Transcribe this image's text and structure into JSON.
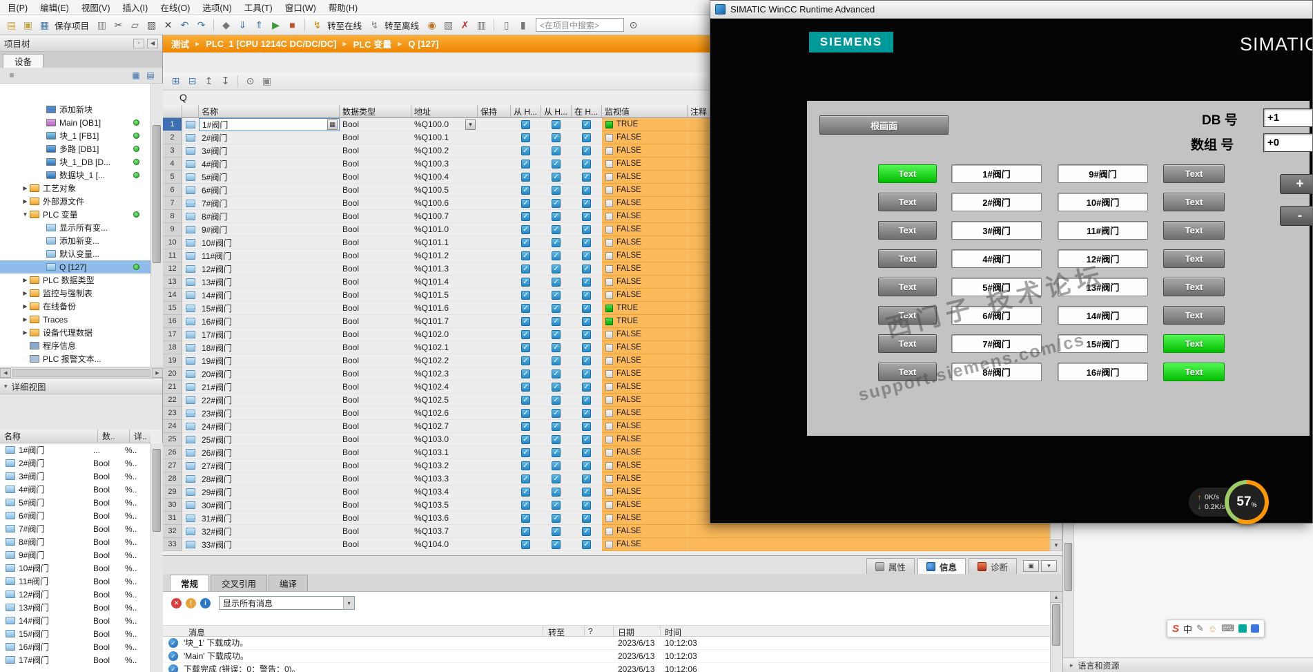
{
  "menubar": {
    "items": [
      "目(P)",
      "编辑(E)",
      "视图(V)",
      "插入(I)",
      "在线(O)",
      "选项(N)",
      "工具(T)",
      "窗口(W)",
      "帮助(H)"
    ]
  },
  "toolbar": {
    "search_placeholder": "<在项目中搜索>",
    "items": [
      {
        "n": "new-project-icon",
        "g": "▤",
        "c": "#D9A441"
      },
      {
        "n": "open-project-icon",
        "g": "▣",
        "c": "#C2A84A"
      },
      {
        "n": "save-project-icon",
        "g": "▦",
        "c": "#4A7CB8"
      },
      {
        "n": "save-project-label",
        "t": "保存项目"
      },
      {
        "n": "print-icon",
        "g": "▥",
        "c": "#8A8A8A"
      },
      {
        "n": "cut-icon",
        "g": "✂",
        "c": "#555"
      },
      {
        "n": "copy-icon",
        "g": "▱",
        "c": "#555"
      },
      {
        "n": "paste-icon",
        "g": "▨",
        "c": "#555"
      },
      {
        "n": "delete-icon",
        "g": "✕",
        "c": "#444"
      },
      {
        "n": "undo-icon",
        "g": "↶",
        "c": "#3A6FB0"
      },
      {
        "n": "redo-icon",
        "g": "↷",
        "c": "#3A6FB0"
      },
      {
        "sep": true
      },
      {
        "n": "compile-icon",
        "g": "◆",
        "c": "#777777"
      },
      {
        "n": "download-to-device-icon",
        "g": "⇓",
        "c": "#3A6FB0"
      },
      {
        "n": "upload-from-device-icon",
        "g": "⇑",
        "c": "#3A6FB0"
      },
      {
        "n": "start-cpu-icon",
        "g": "▶",
        "c": "#3A9A3A"
      },
      {
        "n": "stop-cpu-icon",
        "g": "■",
        "c": "#C05030"
      },
      {
        "sep": true
      },
      {
        "n": "go-online-icon",
        "g": "↯",
        "c": "#D88500"
      },
      {
        "n": "go-online-label",
        "t": "转至在线"
      },
      {
        "n": "go-offline-icon",
        "g": "↯",
        "c": "#888888"
      },
      {
        "n": "go-offline-label",
        "t": "转至离线"
      },
      {
        "n": "online-diagnostics-icon",
        "g": "◉",
        "c": "#C07020"
      },
      {
        "n": "simulation-icon",
        "g": "▧",
        "c": "#777777"
      },
      {
        "n": "cancel-icon",
        "g": "✗",
        "c": "#C03030"
      },
      {
        "n": "cross-reference-icon",
        "g": "▥",
        "c": "#777777"
      },
      {
        "sep": true
      },
      {
        "n": "split-editor-vertical-icon",
        "g": "▯",
        "c": "#777777"
      },
      {
        "n": "split-editor-horizontal-icon",
        "g": "▮",
        "c": "#777777"
      },
      {
        "search": true
      },
      {
        "n": "find-icon",
        "g": "⊙",
        "c": "#555555"
      }
    ]
  },
  "breadcrumb": {
    "items": [
      "测试",
      "PLC_1 [CPU 1214C DC/DC/DC]",
      "PLC 变量",
      "Q [127]"
    ]
  },
  "project_tree": {
    "title": "项目树",
    "tab": "设备",
    "items": [
      {
        "l": "添加新块",
        "lv": 3,
        "ic": "add"
      },
      {
        "l": "Main [OB1]",
        "lv": 3,
        "ic": "ob",
        "dot": 1
      },
      {
        "l": "块_1 [FB1]",
        "lv": 3,
        "ic": "fb",
        "dot": 1
      },
      {
        "l": "多路 [DB1]",
        "lv": 3,
        "ic": "db",
        "dot": 1
      },
      {
        "l": "块_1_DB [D...",
        "lv": 3,
        "ic": "db",
        "dot": 1
      },
      {
        "l": "数据块_1 [...",
        "lv": 3,
        "ic": "db",
        "dot": 1
      },
      {
        "l": "工艺对象",
        "lv": 2,
        "ic": "folder",
        "ar": "c"
      },
      {
        "l": "外部源文件",
        "lv": 2,
        "ic": "folder",
        "ar": "c"
      },
      {
        "l": "PLC 变量",
        "lv": 2,
        "ic": "tagfolder",
        "ar": "e",
        "dot": 1
      },
      {
        "l": "显示所有变...",
        "lv": 3,
        "ic": "tag"
      },
      {
        "l": "添加新变...",
        "lv": 3,
        "ic": "tagadd"
      },
      {
        "l": "默认变量...",
        "lv": 3,
        "ic": "tag"
      },
      {
        "l": "Q [127]",
        "lv": 3,
        "ic": "tag",
        "dot": 1,
        "sel": 1
      },
      {
        "l": "PLC 数据类型",
        "lv": 2,
        "ic": "folder2",
        "ar": "c"
      },
      {
        "l": "监控与强制表",
        "lv": 2,
        "ic": "folder2",
        "ar": "c"
      },
      {
        "l": "在线备份",
        "lv": 2,
        "ic": "folder2",
        "ar": "c"
      },
      {
        "l": "Traces",
        "lv": 2,
        "ic": "folder2",
        "ar": "c"
      },
      {
        "l": "设备代理数据",
        "lv": 2,
        "ic": "folder2",
        "ar": "c"
      },
      {
        "l": "程序信息",
        "lv": 2,
        "ic": "info"
      },
      {
        "l": "PLC 报警文本...",
        "lv": 2,
        "ic": "alarm"
      }
    ]
  },
  "detail_view": {
    "title": "详细视图",
    "columns": [
      "名称",
      "数..",
      "详.."
    ],
    "rows": [
      [
        "1#阀门",
        "...",
        "%.."
      ],
      [
        "2#阀门",
        "Bool",
        "%.."
      ],
      [
        "3#阀门",
        "Bool",
        "%.."
      ],
      [
        "4#阀门",
        "Bool",
        "%.."
      ],
      [
        "5#阀门",
        "Bool",
        "%.."
      ],
      [
        "6#阀门",
        "Bool",
        "%.."
      ],
      [
        "7#阀门",
        "Bool",
        "%.."
      ],
      [
        "8#阀门",
        "Bool",
        "%.."
      ],
      [
        "9#阀门",
        "Bool",
        "%.."
      ],
      [
        "10#阀门",
        "Bool",
        "%.."
      ],
      [
        "11#阀门",
        "Bool",
        "%.."
      ],
      [
        "12#阀门",
        "Bool",
        "%.."
      ],
      [
        "13#阀门",
        "Bool",
        "%.."
      ],
      [
        "14#阀门",
        "Bool",
        "%.."
      ],
      [
        "15#阀门",
        "Bool",
        "%.."
      ],
      [
        "16#阀门",
        "Bool",
        "%.."
      ],
      [
        "17#阀门",
        "Bool",
        "%.."
      ]
    ]
  },
  "table_toolbar": {
    "items": [
      {
        "n": "add-row-icon",
        "g": "⊞",
        "c": "#4A7CB8"
      },
      {
        "n": "insert-row-icon",
        "g": "⊟",
        "c": "#4A7CB8"
      },
      {
        "n": "export-icon",
        "g": "↥",
        "c": "#666666"
      },
      {
        "n": "import-icon",
        "g": "↧",
        "c": "#666666"
      },
      {
        "sep": true
      },
      {
        "n": "monitor-all-icon",
        "g": "⊙",
        "c": "#666666"
      },
      {
        "n": "snapshot-icon",
        "g": "▣",
        "c": "#888888"
      }
    ]
  },
  "tag_table": {
    "title": "Q",
    "columns": [
      "名称",
      "数据类型",
      "地址",
      "保持",
      "从 H...",
      "从 H...",
      "在 H...",
      "监视值",
      "注释"
    ],
    "selected_row": 0,
    "rows": [
      [
        "1#阀门",
        "Bool",
        "%Q100.0",
        "TRUE"
      ],
      [
        "2#阀门",
        "Bool",
        "%Q100.1",
        "FALSE"
      ],
      [
        "3#阀门",
        "Bool",
        "%Q100.2",
        "FALSE"
      ],
      [
        "4#阀门",
        "Bool",
        "%Q100.3",
        "FALSE"
      ],
      [
        "5#阀门",
        "Bool",
        "%Q100.4",
        "FALSE"
      ],
      [
        "6#阀门",
        "Bool",
        "%Q100.5",
        "FALSE"
      ],
      [
        "7#阀门",
        "Bool",
        "%Q100.6",
        "FALSE"
      ],
      [
        "8#阀门",
        "Bool",
        "%Q100.7",
        "FALSE"
      ],
      [
        "9#阀门",
        "Bool",
        "%Q101.0",
        "FALSE"
      ],
      [
        "10#阀门",
        "Bool",
        "%Q101.1",
        "FALSE"
      ],
      [
        "11#阀门",
        "Bool",
        "%Q101.2",
        "FALSE"
      ],
      [
        "12#阀门",
        "Bool",
        "%Q101.3",
        "FALSE"
      ],
      [
        "13#阀门",
        "Bool",
        "%Q101.4",
        "FALSE"
      ],
      [
        "14#阀门",
        "Bool",
        "%Q101.5",
        "FALSE"
      ],
      [
        "15#阀门",
        "Bool",
        "%Q101.6",
        "TRUE"
      ],
      [
        "16#阀门",
        "Bool",
        "%Q101.7",
        "TRUE"
      ],
      [
        "17#阀门",
        "Bool",
        "%Q102.0",
        "FALSE"
      ],
      [
        "18#阀门",
        "Bool",
        "%Q102.1",
        "FALSE"
      ],
      [
        "19#阀门",
        "Bool",
        "%Q102.2",
        "FALSE"
      ],
      [
        "20#阀门",
        "Bool",
        "%Q102.3",
        "FALSE"
      ],
      [
        "21#阀门",
        "Bool",
        "%Q102.4",
        "FALSE"
      ],
      [
        "22#阀门",
        "Bool",
        "%Q102.5",
        "FALSE"
      ],
      [
        "23#阀门",
        "Bool",
        "%Q102.6",
        "FALSE"
      ],
      [
        "24#阀门",
        "Bool",
        "%Q102.7",
        "FALSE"
      ],
      [
        "25#阀门",
        "Bool",
        "%Q103.0",
        "FALSE"
      ],
      [
        "26#阀门",
        "Bool",
        "%Q103.1",
        "FALSE"
      ],
      [
        "27#阀门",
        "Bool",
        "%Q103.2",
        "FALSE"
      ],
      [
        "28#阀门",
        "Bool",
        "%Q103.3",
        "FALSE"
      ],
      [
        "29#阀门",
        "Bool",
        "%Q103.4",
        "FALSE"
      ],
      [
        "30#阀门",
        "Bool",
        "%Q103.5",
        "FALSE"
      ],
      [
        "31#阀门",
        "Bool",
        "%Q103.6",
        "FALSE"
      ],
      [
        "32#阀门",
        "Bool",
        "%Q103.7",
        "FALSE"
      ],
      [
        "33#阀门",
        "Bool",
        "%Q104.0",
        "FALSE"
      ]
    ]
  },
  "inspector": {
    "tabs": [
      {
        "key": "properties",
        "label": "属性"
      },
      {
        "key": "info",
        "label": "信息",
        "active": true
      },
      {
        "key": "diagnostics",
        "label": "诊断"
      }
    ],
    "subtabs": [
      {
        "label": "常规",
        "active": true
      },
      {
        "label": "交叉引用"
      },
      {
        "label": "编译"
      }
    ],
    "filter_label": "显示所有消息",
    "filter_icons": [
      {
        "n": "error-filter-icon",
        "g": "✕",
        "bg": "#D84040"
      },
      {
        "n": "warning-filter-icon",
        "g": "!",
        "bg": "#E8A33B"
      },
      {
        "n": "info-filter-icon",
        "g": "i",
        "bg": "#2C77C8"
      }
    ],
    "columns": [
      "消息",
      "转至",
      "?",
      "日期",
      "时间"
    ],
    "messages": [
      {
        "text": "'块_1' 下载成功。",
        "date": "2023/6/13",
        "time": "10:12:03"
      },
      {
        "text": "'Main' 下载成功。",
        "date": "2023/6/13",
        "time": "10:12:03"
      },
      {
        "text": "下载完成 (错误：0：警告：0)。",
        "date": "2023/6/13",
        "time": "10:12:06"
      }
    ]
  },
  "right_panel": {
    "section": "语言和资源"
  },
  "wincc": {
    "title": "SIMATIC WinCC Runtime Advanced",
    "brand": "SIEMENS",
    "header_right": "SIMATIC",
    "home_button": "根画面",
    "db_label": "DB 号",
    "db_value": "+1",
    "array_label": "数组 号",
    "array_value": "+0",
    "plus_button": "+",
    "minus_button": "-",
    "watermark_line1": "西门子 技术论坛",
    "watermark_line2": "support.siemens.com/cs",
    "grid": [
      [
        {
          "t": "Text",
          "g": 1
        },
        {
          "t": "Text"
        },
        {
          "t": "Text"
        },
        {
          "t": "Text"
        },
        {
          "t": "Text"
        },
        {
          "t": "Text"
        },
        {
          "t": "Text"
        },
        {
          "t": "Text"
        }
      ],
      [
        {
          "t": "1#阀门"
        },
        {
          "t": "2#阀门"
        },
        {
          "t": "3#阀门"
        },
        {
          "t": "4#阀门"
        },
        {
          "t": "5#阀门"
        },
        {
          "t": "6#阀门"
        },
        {
          "t": "7#阀门"
        },
        {
          "t": "8#阀门"
        }
      ],
      [
        {
          "t": "9#阀门"
        },
        {
          "t": "10#阀门"
        },
        {
          "t": "11#阀门"
        },
        {
          "t": "12#阀门"
        },
        {
          "t": "13#阀门"
        },
        {
          "t": "14#阀门"
        },
        {
          "t": "15#阀门"
        },
        {
          "t": "16#阀门"
        }
      ],
      [
        {
          "t": "Text"
        },
        {
          "t": "Text"
        },
        {
          "t": "Text"
        },
        {
          "t": "Text"
        },
        {
          "t": "Text"
        },
        {
          "t": "Text"
        },
        {
          "t": "Text",
          "g": 1
        },
        {
          "t": "Text",
          "g": 1
        }
      ]
    ]
  },
  "gauge": {
    "percent": "57",
    "unit": "%",
    "upload_speed": "0K/s",
    "download_speed": "0.2K/s"
  },
  "ime": {
    "items": [
      {
        "g": "S",
        "c": "#E8442E",
        "n": "ime-logo-icon",
        "cls": "logo"
      },
      {
        "g": "中",
        "c": "#222222",
        "n": "ime-language-icon"
      },
      {
        "g": "✎",
        "c": "#666666",
        "n": "ime-pen-icon"
      },
      {
        "g": "☺",
        "c": "#E8A33B",
        "n": "ime-emoji-icon"
      },
      {
        "g": "⌨",
        "c": "#555555",
        "n": "ime-keyboard-icon"
      },
      {
        "g": "",
        "bg": "#00A99D",
        "n": "ime-tool-teal-icon"
      },
      {
        "g": "",
        "bg": "#3B78DE",
        "n": "ime-tool-blue-icon"
      }
    ]
  },
  "icons": {
    "up": "▲",
    "down": "▼",
    "left": "◀",
    "right": "▶",
    "down_small": "▾",
    "right_small": "▸",
    "box": "▫",
    "menu": "≡",
    "grid": "▦",
    "grid2": "▤",
    "window": "▣",
    "check": "✓",
    "arrow_up": "↑",
    "arrow_down": "↓",
    "breadcrumb_sep": "▶"
  }
}
